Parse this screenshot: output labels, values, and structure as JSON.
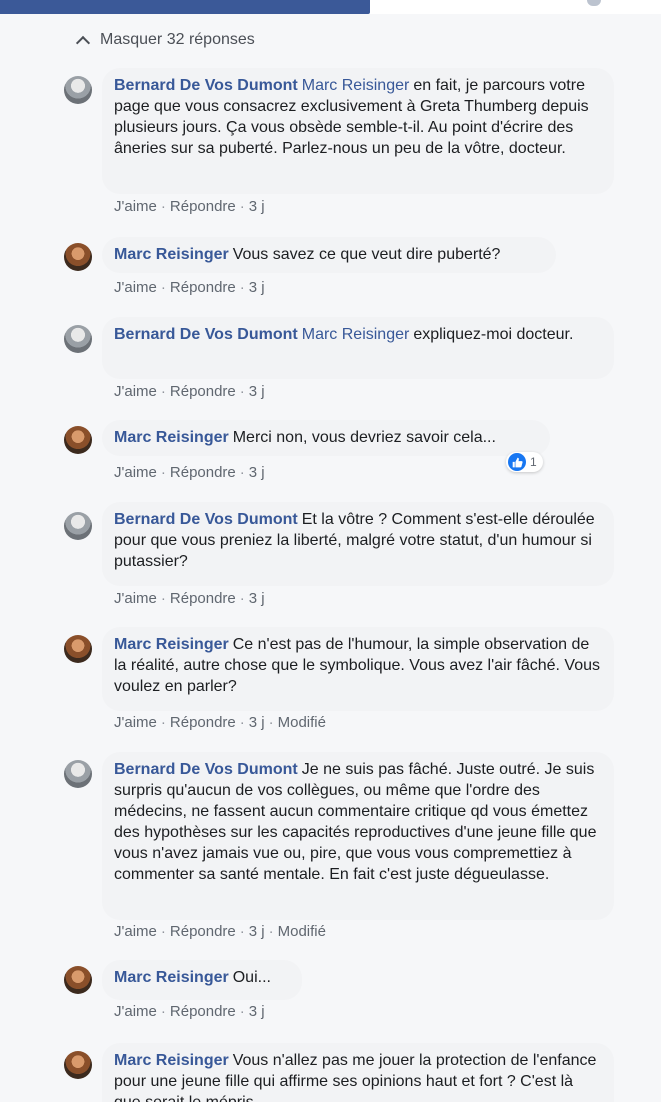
{
  "header": {
    "hide_replies_label": "Masquer 32 réponses"
  },
  "colors": {
    "author_link": "#385898",
    "bubble_bg": "#f2f3f5",
    "page_bg": "#f6f7f9",
    "topbar": "#3b5998"
  },
  "comments": [
    {
      "author": "Bernard De Vos Dumont",
      "mention": "Marc Reisinger",
      "text": "en fait, je parcours votre page que vous consacrez exclusivement à Greta Thumberg depuis plusieurs jours. Ça vous obsède semble-t-il. Au point d'écrire des âneries sur sa puberté. Parlez-nous un peu de la vôtre, docteur.",
      "like": "J'aime",
      "reply": "Répondre",
      "time": "3 j",
      "edited": ""
    },
    {
      "author": "Marc Reisinger",
      "mention": "",
      "text": "Vous savez ce que veut dire puberté?",
      "like": "J'aime",
      "reply": "Répondre",
      "time": "3 j",
      "edited": ""
    },
    {
      "author": "Bernard De Vos Dumont",
      "mention": "Marc Reisinger",
      "text": "expliquez-moi docteur.",
      "like": "J'aime",
      "reply": "Répondre",
      "time": "3 j",
      "edited": ""
    },
    {
      "author": "Marc Reisinger",
      "mention": "",
      "text": "Merci non, vous devriez savoir cela...",
      "like": "J'aime",
      "reply": "Répondre",
      "time": "3 j",
      "edited": "",
      "reaction_count": "1"
    },
    {
      "author": "Bernard De Vos Dumont",
      "mention": "",
      "text": "Et la vôtre ? Comment s'est-elle déroulée pour que vous preniez la liberté, malgré votre statut, d'un humour si putassier?",
      "like": "J'aime",
      "reply": "Répondre",
      "time": "3 j",
      "edited": ""
    },
    {
      "author": "Marc Reisinger",
      "mention": "",
      "text": "Ce n'est pas de l'humour, la simple observation de la réalité, autre chose que le symbolique. Vous avez l'air fâché. Vous voulez en parler?",
      "like": "J'aime",
      "reply": "Répondre",
      "time": "3 j",
      "edited": "Modifié"
    },
    {
      "author": "Bernard De Vos Dumont",
      "mention": "",
      "text": "Je ne suis pas fâché. Juste outré. Je suis surpris qu'aucun de vos collègues, ou même que l'ordre des médecins, ne fassent aucun commentaire critique qd vous émettez des hypothèses sur les capacités reproductives d'une jeune fille que vous n'avez jamais vue ou, pire, que vous vous compremettiez à commenter sa santé mentale. En fait c'est juste dégueulasse.",
      "like": "J'aime",
      "reply": "Répondre",
      "time": "3 j",
      "edited": "Modifié"
    },
    {
      "author": "Marc Reisinger",
      "mention": "",
      "text": "Oui...",
      "like": "J'aime",
      "reply": "Répondre",
      "time": "3 j",
      "edited": ""
    },
    {
      "author": "Marc Reisinger",
      "mention": "",
      "text": "Vous n'allez pas me jouer la protection de l'enfance pour une jeune fille qui affirme ses opinions haut et fort ? C'est là que serait le mépris",
      "like": "",
      "reply": "",
      "time": "",
      "edited": ""
    }
  ]
}
